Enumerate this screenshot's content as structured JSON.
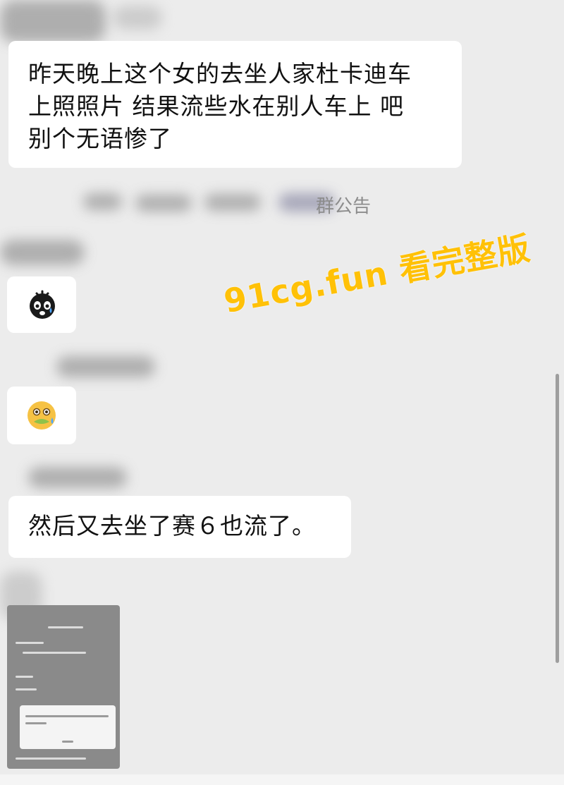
{
  "messages": [
    {
      "id": "m1",
      "text": "昨天晚上这个女的去坐人家杜卡迪车\n上照照片 结果流些水在别人车上 吧\n别个无语惨了"
    },
    {
      "id": "m2",
      "emoji": "crying-bomb"
    },
    {
      "id": "m3",
      "emoji": "nauseated-face"
    },
    {
      "id": "m4",
      "text": "然后又去坐了赛６也流了。"
    }
  ],
  "system_notice": {
    "visible_fragment": "群公告"
  },
  "watermark": {
    "text": "91cg.fun 看完整版",
    "color": "#ffc107"
  },
  "thumbnail": {
    "icon": "phone-screenshot-image"
  },
  "colors": {
    "background": "#ececec",
    "bubble": "#ffffff",
    "text": "#111111"
  }
}
